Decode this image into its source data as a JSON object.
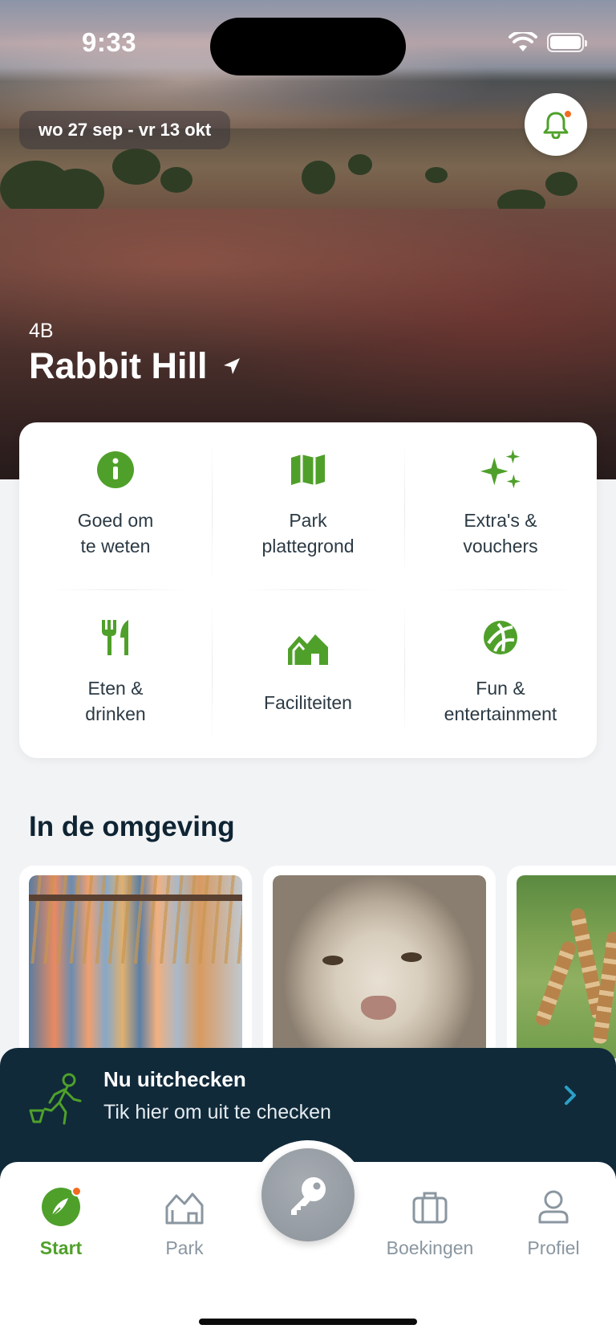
{
  "status_bar": {
    "time": "9:33"
  },
  "hero": {
    "date_range": "wo 27 sep - vr 13 okt",
    "unit": "4B",
    "park_name": "Rabbit Hill"
  },
  "quick_menu": [
    {
      "label": "Goed om\nte weten",
      "icon": "info-icon"
    },
    {
      "label": "Park\nplattegrond",
      "icon": "map-icon"
    },
    {
      "label": "Extra's &\nvouchers",
      "icon": "sparkles-icon"
    },
    {
      "label": "Eten &\ndrinken",
      "icon": "cutlery-icon"
    },
    {
      "label": "Faciliteiten",
      "icon": "houses-icon"
    },
    {
      "label": "Fun &\nentertainment",
      "icon": "ball-icon"
    }
  ],
  "surroundings": {
    "title": "In de omgeving",
    "cards": [
      {
        "image": "clothing-rack-photo"
      },
      {
        "image": "white-lion-photo"
      },
      {
        "image": "giraffes-photo"
      }
    ]
  },
  "checkout": {
    "title": "Nu uitchecken",
    "subtitle": "Tik hier om uit te checken"
  },
  "tabbar": {
    "tabs": [
      {
        "label": "Start",
        "icon": "start-icon",
        "active": true
      },
      {
        "label": "Park",
        "icon": "house-icon",
        "active": false
      },
      {
        "label": "Boekingen",
        "icon": "briefcase-icon",
        "active": false
      },
      {
        "label": "Profiel",
        "icon": "person-icon",
        "active": false
      }
    ],
    "center_button_icon": "key-icon"
  },
  "colors": {
    "accent_green": "#4fa02a",
    "dark_navy": "#102a3a",
    "notification_orange": "#f26b21",
    "checkout_chevron": "#2aa0c8"
  }
}
